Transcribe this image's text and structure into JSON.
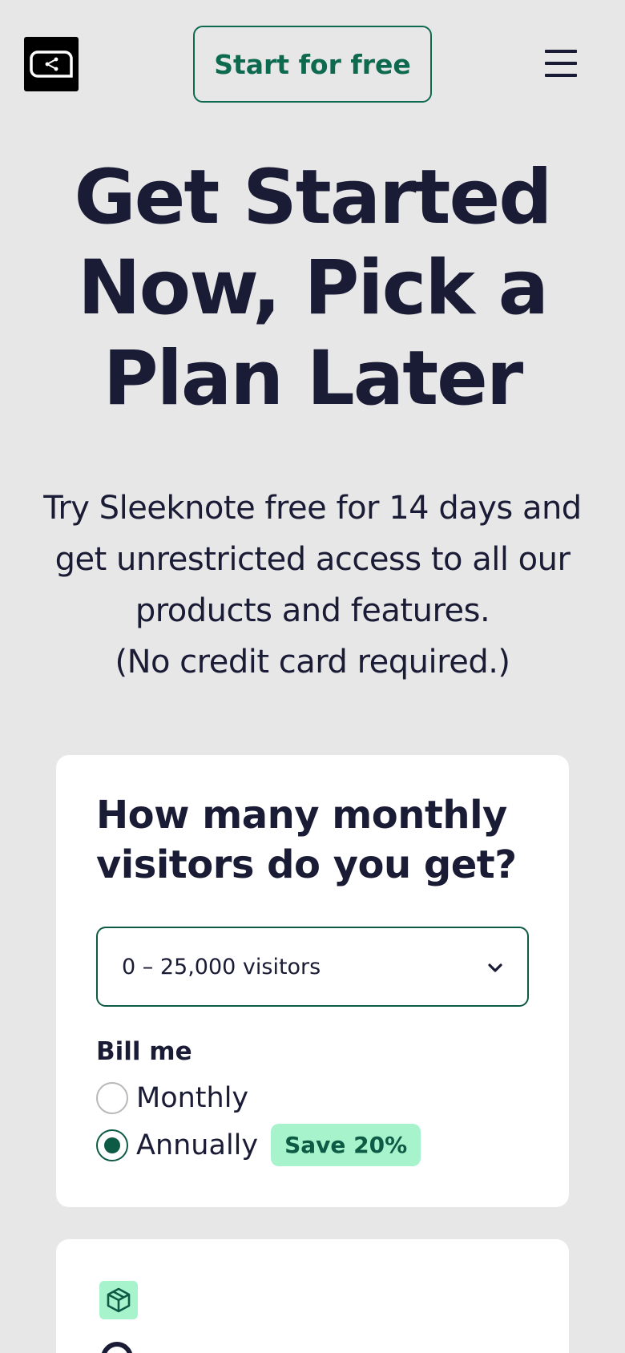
{
  "header": {
    "logo_icon": "sleeknote-logo-icon",
    "cta_label": "Start for free",
    "menu_icon": "hamburger-menu-icon"
  },
  "hero": {
    "title": "Get Started Now, Pick a Plan Later",
    "subtitle_line1": "Try Sleeknote free for 14 days and get unrestricted access to all our products and features.",
    "subtitle_line2": "(No credit card required.)"
  },
  "visitors_card": {
    "question": "How many monthly visitors do you get?",
    "select_value": "0 – 25,000 visitors",
    "select_icon": "chevron-down-icon",
    "bill_label": "Bill me",
    "options": [
      {
        "label": "Monthly",
        "checked": false
      },
      {
        "label": "Annually",
        "checked": true
      }
    ],
    "save_badge": "Save 20%"
  },
  "plan_card": {
    "icon": "package-box-icon"
  },
  "colors": {
    "background": "#e7e7e7",
    "brand_green": "#0d6a4f",
    "badge_green": "#a6f3cc",
    "text_dark": "#1a1b35"
  }
}
